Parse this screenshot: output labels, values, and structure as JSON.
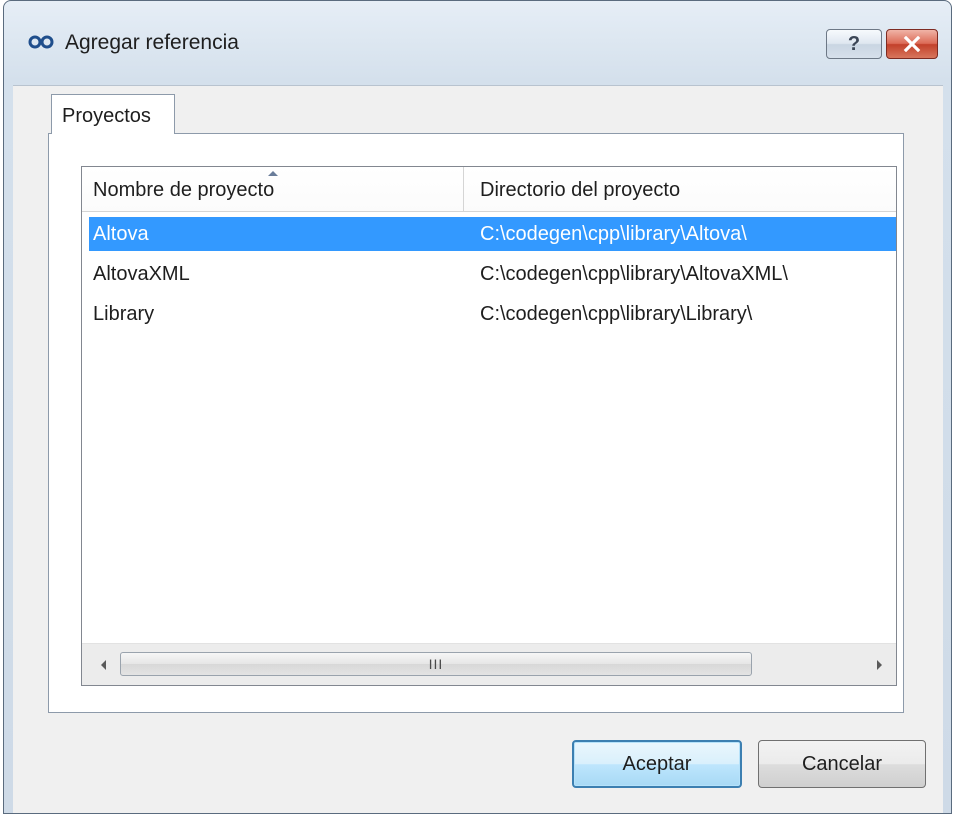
{
  "window": {
    "title": "Agregar referencia",
    "help_glyph": "?",
    "close_glyph": "×",
    "accent_close": "#c2402a",
    "icon": "double-ring-link-icon"
  },
  "tabs": [
    {
      "label": "Proyectos",
      "active": true
    }
  ],
  "table": {
    "columns": [
      "Nombre de proyecto",
      "Directorio del proyecto"
    ],
    "sort_column": 0,
    "sort_direction": "ascending",
    "rows": [
      {
        "name": "Altova",
        "dir": "C:\\codegen\\cpp\\library\\Altova\\",
        "selected": true
      },
      {
        "name": "AltovaXML",
        "dir": "C:\\codegen\\cpp\\library\\AltovaXML\\",
        "selected": false
      },
      {
        "name": "Library",
        "dir": "C:\\codegen\\cpp\\library\\Library\\",
        "selected": false
      }
    ],
    "selection_color": "#3399ff",
    "scrollbar_grip": "III"
  },
  "buttons": {
    "ok_label": "Aceptar",
    "cancel_label": "Cancelar"
  }
}
